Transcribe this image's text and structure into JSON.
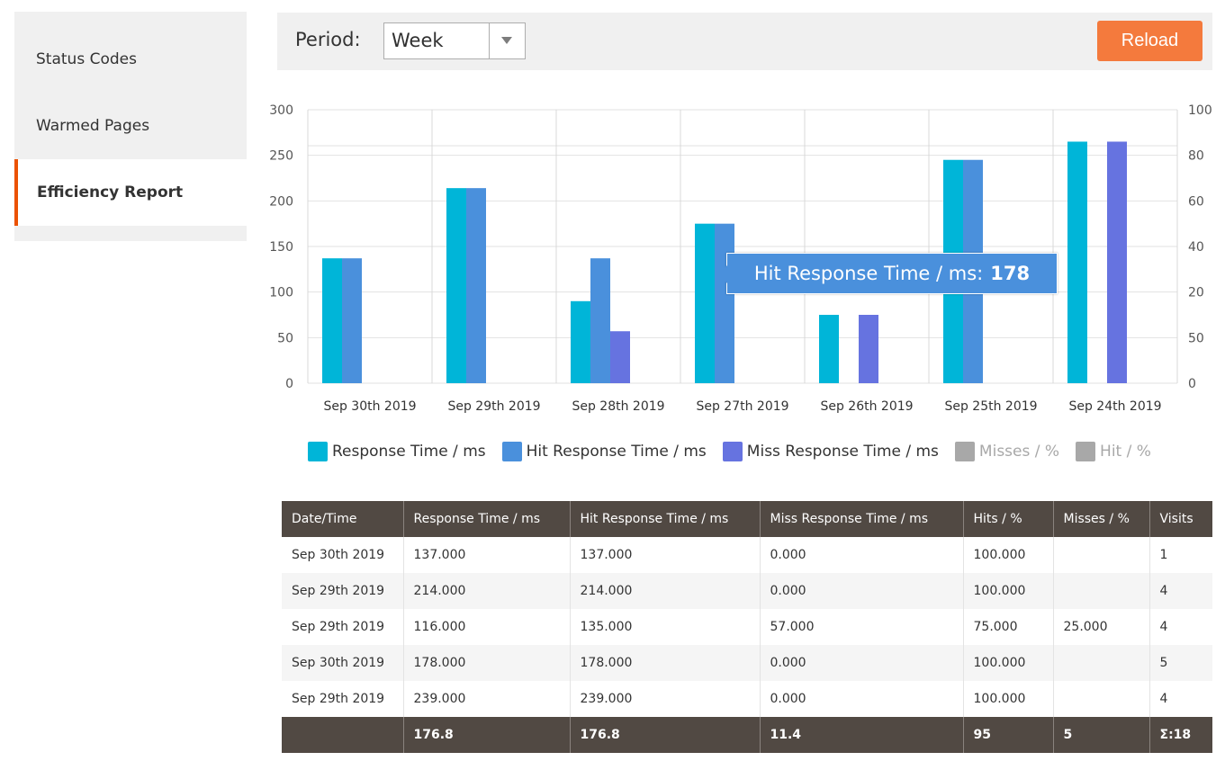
{
  "sidebar": {
    "items": [
      {
        "label": "Status Codes",
        "active": false
      },
      {
        "label": "Warmed Pages",
        "active": false
      },
      {
        "label": "Efficiency Report",
        "active": true
      }
    ]
  },
  "toolbar": {
    "period_label": "Period:",
    "period_value": "Week",
    "reload_label": "Reload"
  },
  "colors": {
    "response_time": "#00b5d8",
    "hit_response_time": "#4a90dc",
    "miss_response_time": "#6673e0",
    "muted": "#a8a8a8",
    "accent": "#f47a3d",
    "table_header": "#514943"
  },
  "chart_data": {
    "type": "bar",
    "categories": [
      "Sep 30th 2019",
      "Sep 29th 2019",
      "Sep 28th 2019",
      "Sep 27th 2019",
      "Sep 26th 2019",
      "Sep 25th 2019",
      "Sep 24th 2019"
    ],
    "series": [
      {
        "name": "Response Time / ms",
        "values": [
          137,
          214,
          90,
          175,
          75,
          245,
          265
        ],
        "color": "#00b5d8",
        "axis": "left"
      },
      {
        "name": "Hit Response Time / ms",
        "values": [
          137,
          214,
          137,
          175,
          0,
          245,
          0
        ],
        "color": "#4a90dc",
        "axis": "left"
      },
      {
        "name": "Miss Response Time / ms",
        "values": [
          0,
          0,
          57,
          0,
          75,
          0,
          265
        ],
        "color": "#6673e0",
        "axis": "left"
      }
    ],
    "hidden_series": [
      {
        "name": "Misses / %",
        "color": "#a8a8a8"
      },
      {
        "name": "Hit / %",
        "color": "#a8a8a8"
      }
    ],
    "y_left_ticks": [
      "300",
      "250",
      "200",
      "150",
      "100",
      "50",
      "0"
    ],
    "y_right_ticks": [
      "100",
      "80",
      "60",
      "40",
      "20",
      "50",
      "0"
    ],
    "ylim": [
      0,
      300
    ],
    "tooltip": {
      "label": "Hit Response Time / ms:",
      "value": "178"
    },
    "legend_position": "bottom"
  },
  "table": {
    "headers": [
      "Date/Time",
      "Response Time / ms",
      "Hit Response Time / ms",
      "Miss Response Time / ms",
      "Hits / %",
      "Misses / %",
      "Visits"
    ],
    "rows": [
      [
        "Sep 30th 2019",
        "137.000",
        "137.000",
        "0.000",
        "100.000",
        "",
        "1"
      ],
      [
        "Sep 29th 2019",
        "214.000",
        "214.000",
        "0.000",
        "100.000",
        "",
        "4"
      ],
      [
        "Sep 29th 2019",
        "116.000",
        "135.000",
        "57.000",
        "75.000",
        "25.000",
        "4"
      ],
      [
        "Sep 30th 2019",
        "178.000",
        "178.000",
        "0.000",
        "100.000",
        "",
        "5"
      ],
      [
        "Sep 29th 2019",
        "239.000",
        "239.000",
        "0.000",
        "100.000",
        "",
        "4"
      ]
    ],
    "footer": [
      "",
      "176.8",
      "176.8",
      "11.4",
      "95",
      "5",
      "Σ:18"
    ]
  }
}
